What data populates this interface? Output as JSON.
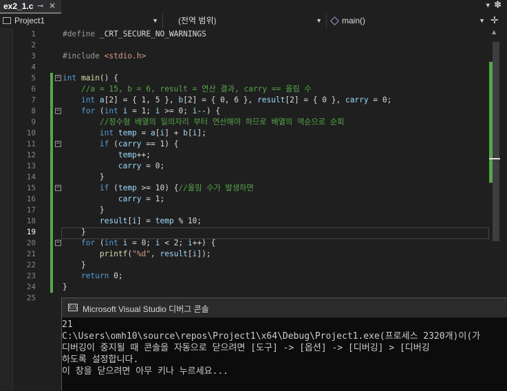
{
  "tab": {
    "title": "ex2_1.c",
    "pin": "⊸",
    "close": "×",
    "list": "▾",
    "settings": "✽"
  },
  "navbar": {
    "project": "Project1",
    "scope": "(전역 범위)",
    "member": "main()",
    "split": "✛"
  },
  "code_lines": [
    {
      "num": "1",
      "tokens": [
        [
          "pp",
          "#define "
        ],
        [
          "",
          "_CRT_SECURE_NO_WARNINGS"
        ]
      ]
    },
    {
      "num": "2",
      "tokens": []
    },
    {
      "num": "3",
      "tokens": [
        [
          "pp",
          "#include "
        ],
        [
          "s",
          "<stdio.h>"
        ]
      ]
    },
    {
      "num": "4",
      "tokens": []
    },
    {
      "num": "5",
      "tokens": [
        [
          "k",
          "int "
        ],
        [
          "f",
          "main"
        ],
        [
          "",
          "() {"
        ]
      ],
      "fold": "−"
    },
    {
      "num": "6",
      "tokens": [
        [
          "",
          "    "
        ],
        [
          "c",
          "//a = 15, b = 6, result = 연산 결과, carry == 올림 수"
        ]
      ]
    },
    {
      "num": "7",
      "tokens": [
        [
          "",
          "    "
        ],
        [
          "k",
          "int "
        ],
        [
          "v",
          "a"
        ],
        [
          "",
          "[2] = { 1, 5 }, "
        ],
        [
          "v",
          "b"
        ],
        [
          "",
          "[2] = { 0, 6 }, "
        ],
        [
          "v",
          "result"
        ],
        [
          "",
          "[2] = { 0 }, "
        ],
        [
          "v",
          "carry"
        ],
        [
          "",
          " = 0;"
        ]
      ]
    },
    {
      "num": "8",
      "tokens": [
        [
          "",
          "    "
        ],
        [
          "k",
          "for "
        ],
        [
          "",
          "("
        ],
        [
          "k",
          "int "
        ],
        [
          "v",
          "i"
        ],
        [
          "",
          " = 1; "
        ],
        [
          "v",
          "i"
        ],
        [
          "",
          " >= 0; "
        ],
        [
          "v",
          "i"
        ],
        [
          "",
          "--) {"
        ]
      ],
      "fold": "−"
    },
    {
      "num": "9",
      "tokens": [
        [
          "",
          "        "
        ],
        [
          "c",
          "//정수형 배열의 일의자리 부터 연산해야 하므로 배열의 역순으로 순회"
        ]
      ]
    },
    {
      "num": "10",
      "tokens": [
        [
          "",
          "        "
        ],
        [
          "k",
          "int "
        ],
        [
          "v",
          "temp"
        ],
        [
          "",
          " = "
        ],
        [
          "v",
          "a"
        ],
        [
          "",
          "["
        ],
        [
          "v",
          "i"
        ],
        [
          "",
          "] + "
        ],
        [
          "v",
          "b"
        ],
        [
          "",
          "["
        ],
        [
          "v",
          "i"
        ],
        [
          "",
          "];"
        ]
      ]
    },
    {
      "num": "11",
      "tokens": [
        [
          "",
          "        "
        ],
        [
          "k",
          "if "
        ],
        [
          "",
          "("
        ],
        [
          "v",
          "carry"
        ],
        [
          "",
          " == 1) {"
        ]
      ],
      "fold": "−"
    },
    {
      "num": "12",
      "tokens": [
        [
          "",
          "            "
        ],
        [
          "v",
          "temp"
        ],
        [
          "",
          "++;"
        ]
      ]
    },
    {
      "num": "13",
      "tokens": [
        [
          "",
          "            "
        ],
        [
          "v",
          "carry"
        ],
        [
          "",
          " = 0;"
        ]
      ]
    },
    {
      "num": "14",
      "tokens": [
        [
          "",
          "        }"
        ]
      ]
    },
    {
      "num": "15",
      "tokens": [
        [
          "",
          "        "
        ],
        [
          "k",
          "if "
        ],
        [
          "",
          "("
        ],
        [
          "v",
          "temp"
        ],
        [
          "",
          " >= 10) {"
        ],
        [
          "c",
          "//올림 수가 발생하면"
        ]
      ],
      "fold": "−"
    },
    {
      "num": "16",
      "tokens": [
        [
          "",
          "            "
        ],
        [
          "v",
          "carry"
        ],
        [
          "",
          " = 1;"
        ]
      ]
    },
    {
      "num": "17",
      "tokens": [
        [
          "",
          "        }"
        ]
      ]
    },
    {
      "num": "18",
      "tokens": [
        [
          "",
          "        "
        ],
        [
          "v",
          "result"
        ],
        [
          "",
          "["
        ],
        [
          "v",
          "i"
        ],
        [
          "",
          "] = "
        ],
        [
          "v",
          "temp"
        ],
        [
          "",
          " % 10;"
        ]
      ]
    },
    {
      "num": "19",
      "tokens": [
        [
          "",
          "    }"
        ]
      ],
      "current": true
    },
    {
      "num": "20",
      "tokens": [
        [
          "",
          "    "
        ],
        [
          "k",
          "for "
        ],
        [
          "",
          "("
        ],
        [
          "k",
          "int "
        ],
        [
          "v",
          "i"
        ],
        [
          "",
          " = 0; "
        ],
        [
          "v",
          "i"
        ],
        [
          "",
          " < 2; "
        ],
        [
          "v",
          "i"
        ],
        [
          "",
          "++) {"
        ]
      ],
      "fold": "−"
    },
    {
      "num": "21",
      "tokens": [
        [
          "",
          "        "
        ],
        [
          "f",
          "printf"
        ],
        [
          "",
          "("
        ],
        [
          "s",
          "\"%d\""
        ],
        [
          "",
          ", "
        ],
        [
          "v",
          "result"
        ],
        [
          "",
          "["
        ],
        [
          "v",
          "i"
        ],
        [
          "",
          "]);"
        ]
      ]
    },
    {
      "num": "22",
      "tokens": [
        [
          "",
          "    }"
        ]
      ]
    },
    {
      "num": "23",
      "tokens": [
        [
          "",
          "    "
        ],
        [
          "k",
          "return "
        ],
        [
          "",
          "0;"
        ]
      ]
    },
    {
      "num": "24",
      "tokens": [
        [
          "",
          "}"
        ]
      ]
    },
    {
      "num": "25",
      "tokens": []
    }
  ],
  "console": {
    "title": "Microsoft Visual Studio 디버그 콘솔",
    "icon_text": "C:\\",
    "lines": [
      "21",
      "C:\\Users\\omh10\\source\\repos\\Project1\\x64\\Debug\\Project1.exe(프로세스 2320개)이(가",
      "디버깅이 중지될 때 콘솔을 자동으로 닫으려면 [도구] -> [옵션] -> [디버깅] > [디버깅",
      "하도록 설정합니다.",
      "이 창을 닫으려면 아무 키나 누르세요..."
    ]
  }
}
